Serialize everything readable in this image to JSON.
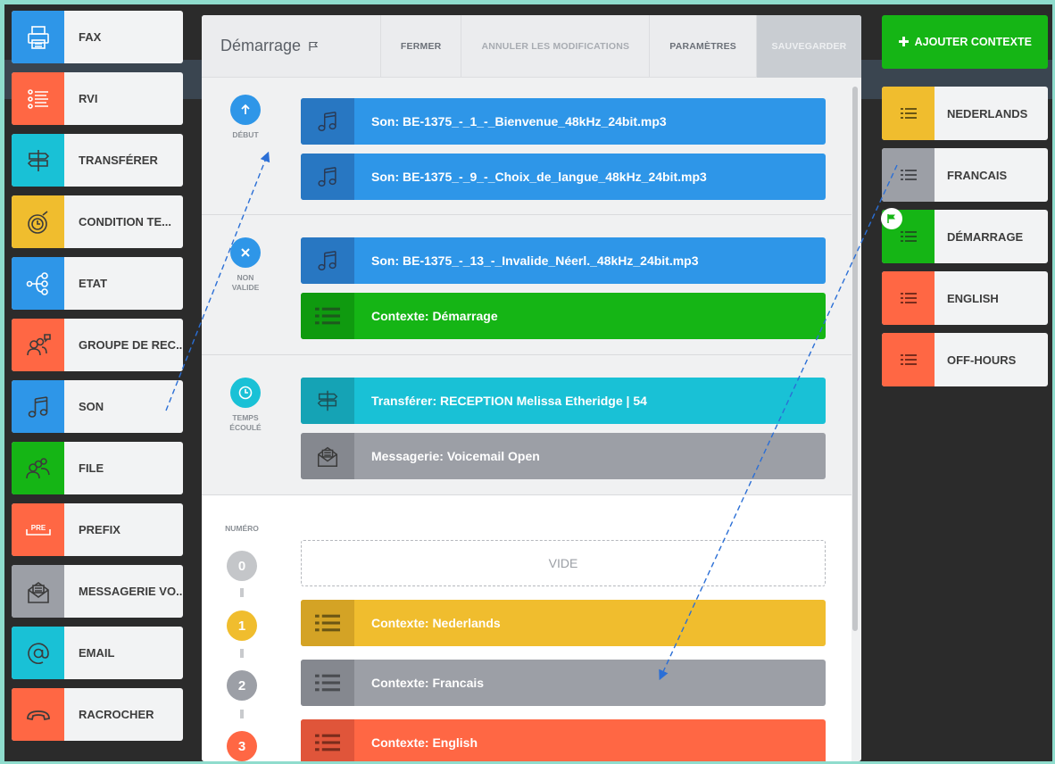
{
  "palette": [
    {
      "label": "FAX",
      "color": "#2e96e8",
      "icon": "fax-icon"
    },
    {
      "label": "RVI",
      "color": "#ff6744",
      "icon": "ivr-menu-icon"
    },
    {
      "label": "TRANSFÉRER",
      "color": "#19c1d6",
      "icon": "signpost-icon"
    },
    {
      "label": "CONDITION TE...",
      "color": "#f0bd2e",
      "icon": "timer-icon"
    },
    {
      "label": "ETAT",
      "color": "#2e96e8",
      "icon": "state-branch-icon"
    },
    {
      "label": "GROUPE DE REC...",
      "color": "#ff6744",
      "icon": "hunt-group-icon"
    },
    {
      "label": "SON",
      "color": "#2e96e8",
      "icon": "music-note-icon"
    },
    {
      "label": "FILE",
      "color": "#15b515",
      "icon": "queue-people-icon"
    },
    {
      "label": "PREFIX",
      "color": "#ff6744",
      "icon": "prefix-icon"
    },
    {
      "label": "MESSAGERIE VO...",
      "color": "#9c9fa6",
      "icon": "voicemail-envelope-icon"
    },
    {
      "label": "EMAIL",
      "color": "#19c1d6",
      "icon": "at-sign-icon"
    },
    {
      "label": "RACROCHER",
      "color": "#ff6744",
      "icon": "hangup-phone-icon"
    }
  ],
  "modal": {
    "title": "Démarrage",
    "buttons": {
      "close": "FERMER",
      "cancel": "ANNULER LES MODIFICATIONS",
      "settings": "PARAMÈTRES",
      "save": "SAUVEGARDER"
    },
    "sections": {
      "start": {
        "label": "DÉBUT",
        "actions": [
          "Son: BE-1375_-_1_-_Bienvenue_48kHz_24bit.mp3",
          "Son: BE-1375_-_9_-_Choix_de_langue_48kHz_24bit.mp3"
        ]
      },
      "invalid": {
        "label_line1": "NON",
        "label_line2": "VALIDE",
        "actions": [
          "Son: BE-1375_-_13_-_Invalide_Néerl._48kHz_24bit.mp3",
          "Contexte: Démarrage"
        ]
      },
      "timeout": {
        "label_line1": "TEMPS",
        "label_line2": "ÉCOULÉ",
        "actions": [
          "Transférer: RECEPTION Melissa Etheridge | 54",
          "Messagerie: Voicemail Open"
        ]
      },
      "digits": {
        "label": "NUMÉRO",
        "items": [
          {
            "digit": "0",
            "text": "VIDE"
          },
          {
            "digit": "1",
            "text": "Contexte: Nederlands"
          },
          {
            "digit": "2",
            "text": "Contexte: Francais"
          },
          {
            "digit": "3",
            "text": "Contexte: English"
          }
        ]
      }
    }
  },
  "contexts": {
    "add_label": "AJOUTER CONTEXTE",
    "items": [
      {
        "label": "NEDERLANDS",
        "color": "#f0bd2e"
      },
      {
        "label": "FRANCAIS",
        "color": "#9c9fa6"
      },
      {
        "label": "DÉMARRAGE",
        "color": "#15b515"
      },
      {
        "label": "ENGLISH",
        "color": "#ff6744"
      },
      {
        "label": "OFF-HOURS",
        "color": "#ff6744"
      }
    ]
  },
  "colors": {
    "blue": "#2e96e8",
    "green": "#15b515",
    "cyan": "#19c1d6",
    "yellow": "#f0bd2e",
    "grey": "#9c9fa6",
    "orange": "#ff6744"
  }
}
